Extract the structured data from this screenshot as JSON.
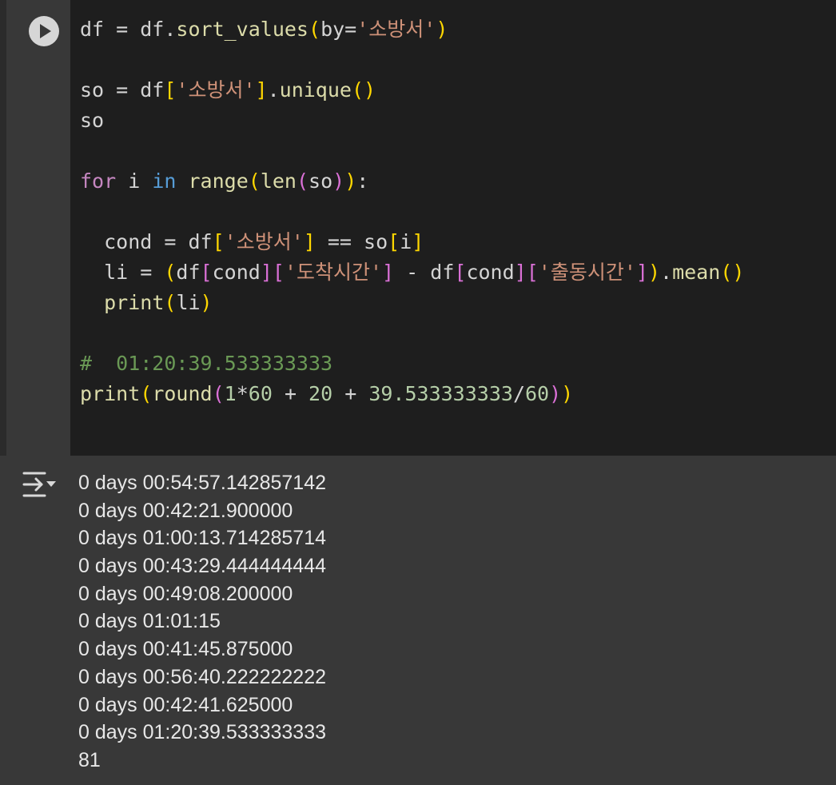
{
  "code_lines": [
    "df = df.sort_values(by='소방서')",
    "",
    "so = df['소방서'].unique()",
    "so",
    "",
    "for i in range(len(so)):",
    "",
    "  cond = df['소방서'] == so[i]",
    "  li = (df[cond]['도착시간'] - df[cond]['출동시간']).mean()",
    "  print(li)",
    "",
    "#  01:20:39.533333333",
    "print(round(1*60 + 20 + 39.533333333/60))"
  ],
  "output_lines": [
    "0 days 00:54:57.142857142",
    "0 days 00:42:21.900000",
    "0 days 01:00:13.714285714",
    "0 days 00:43:29.444444444",
    "0 days 00:49:08.200000",
    "0 days 01:01:15",
    "0 days 00:41:45.875000",
    "0 days 00:56:40.222222222",
    "0 days 00:42:41.625000",
    "0 days 01:20:39.533333333",
    "81"
  ],
  "icons": {
    "run": "play-circle-icon",
    "output": "output-toggle-icon"
  },
  "colors": {
    "editor_bg": "#1e1e1e",
    "output_bg": "#383838",
    "keyword": "#c586c0",
    "string": "#ce9178",
    "function": "#dcdcaa",
    "number": "#b5cea8",
    "comment": "#6a9955"
  }
}
